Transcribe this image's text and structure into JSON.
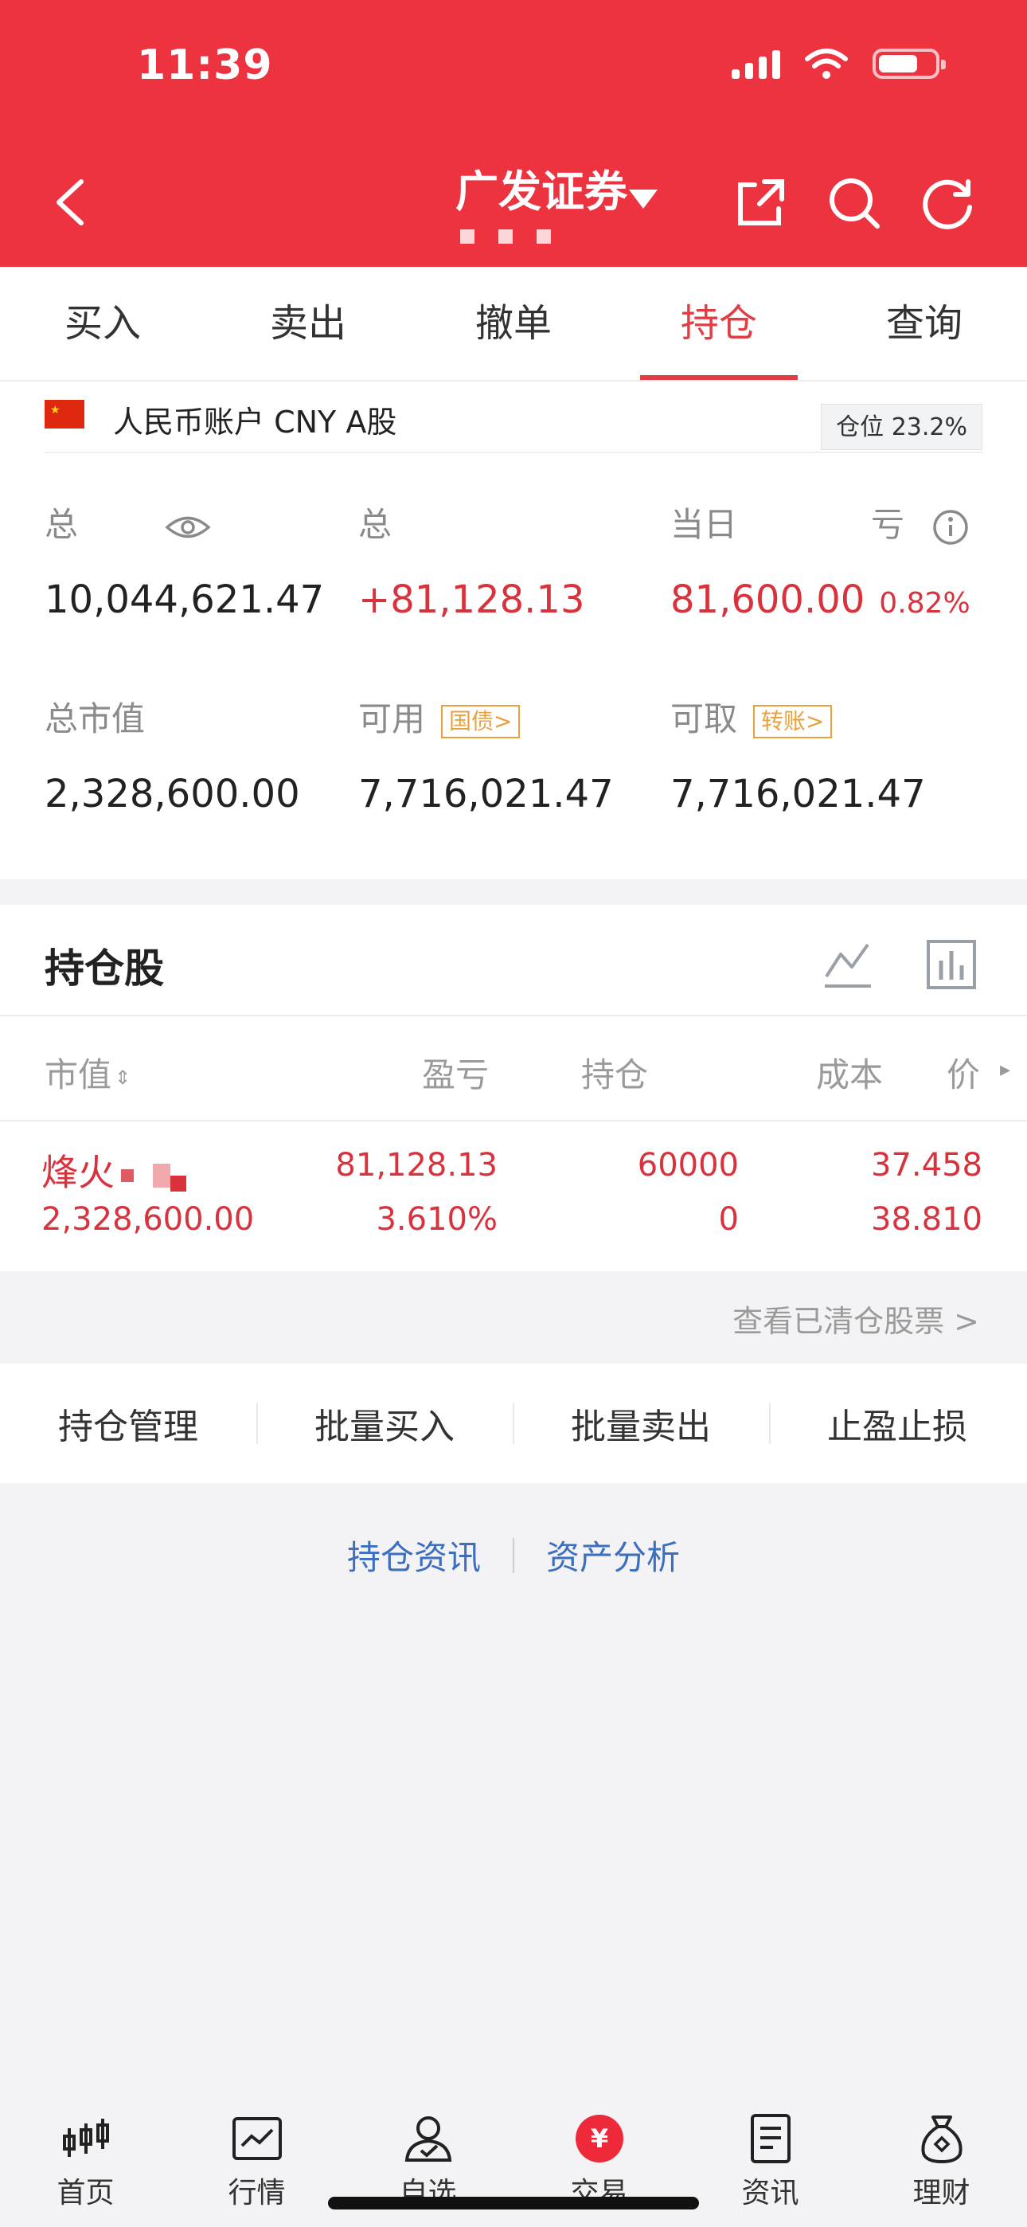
{
  "status_bar": {
    "time": "11:39"
  },
  "header": {
    "title": "广发证券",
    "back_icon": "chevron-left-icon",
    "share_icon": "share-icon",
    "search_icon": "search-icon",
    "refresh_icon": "refresh-icon",
    "bg_color": "#ee3340"
  },
  "tabs": [
    {
      "label": "买入"
    },
    {
      "label": "卖出"
    },
    {
      "label": "撤单"
    },
    {
      "label": "持仓",
      "active": true
    },
    {
      "label": "查询"
    }
  ],
  "account": {
    "label": "人民币账户 CNY A股",
    "position_ratio": "仓位 23.2%",
    "total_assets_label": "总",
    "total_assets": "10,044,621.47",
    "total_pl_label": "总",
    "total_pl": "+81,128.13",
    "daily_pl_label": "当日",
    "daily_pl_label_suffix": "亏",
    "daily_pl": "81,600.00",
    "daily_pl_pct": "0.82%",
    "market_value_label": "总市值",
    "market_value": "2,328,600.00",
    "available_label": "可用",
    "available_tag": "国债>",
    "available": "7,716,021.47",
    "withdrawable_label": "可取",
    "withdrawable_tag": "转账>",
    "withdrawable": "7,716,021.47"
  },
  "holdings": {
    "title": "持仓股",
    "columns": [
      "市值",
      "盈亏",
      "持仓",
      "成本",
      "价"
    ],
    "rows": [
      {
        "name": "烽火",
        "market_value": "2,328,600.00",
        "pl": "81,128.13",
        "pl_pct": "3.610%",
        "qty": "60000",
        "available": "0",
        "cost": "37.458",
        "price": "38.810"
      }
    ],
    "cleared_link": "查看已清仓股票 >"
  },
  "actions": [
    "持仓管理",
    "批量买入",
    "批量卖出",
    "止盈止损"
  ],
  "links": [
    "持仓资讯",
    "资产分析"
  ],
  "nav": [
    {
      "label": "首页",
      "icon": "candlestick-icon"
    },
    {
      "label": "行情",
      "icon": "chart-icon"
    },
    {
      "label": "自选",
      "icon": "user-check-icon"
    },
    {
      "label": "交易",
      "icon": "yuan-icon",
      "active": true
    },
    {
      "label": "资讯",
      "icon": "document-icon"
    },
    {
      "label": "理财",
      "icon": "money-bag-icon"
    }
  ]
}
